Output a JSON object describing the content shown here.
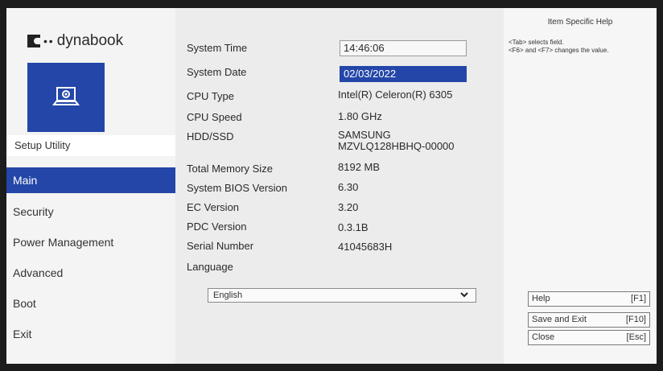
{
  "brand": {
    "logo_text": "dynabook"
  },
  "sidebar": {
    "title": "Setup Utility",
    "items": [
      {
        "label": "Main",
        "active": true
      },
      {
        "label": "Security"
      },
      {
        "label": "Power Management"
      },
      {
        "label": "Advanced"
      },
      {
        "label": "Boot"
      },
      {
        "label": "Exit"
      }
    ]
  },
  "main": {
    "system_time": {
      "label": "System Time",
      "value": "14:46:06"
    },
    "system_date": {
      "label": "System Date",
      "value": "02/03/2022"
    },
    "cpu_type": {
      "label": "CPU Type",
      "value": "Intel(R) Celeron(R) 6305"
    },
    "cpu_speed": {
      "label": "CPU Speed",
      "value": "1.80 GHz"
    },
    "hdd_ssd": {
      "label": "HDD/SSD",
      "value_line1": "SAMSUNG",
      "value_line2": "MZVLQ128HBHQ-00000"
    },
    "total_memory": {
      "label": "Total Memory Size",
      "value": "8192 MB"
    },
    "bios_version": {
      "label": "System BIOS Version",
      "value": "6.30"
    },
    "ec_version": {
      "label": "EC Version",
      "value": "3.20"
    },
    "pdc_version": {
      "label": "PDC Version",
      "value": "0.3.1B"
    },
    "serial_number": {
      "label": "Serial Number",
      "value": "41045683H"
    },
    "language": {
      "label": "Language",
      "value": "English"
    }
  },
  "help": {
    "title": "Item Specific Help",
    "line1": "<Tab> selects field.",
    "line2": "<F6> and <F7> changes the value.",
    "keys": [
      {
        "label": "Help",
        "key": "[F1]"
      },
      {
        "label": "Save and Exit",
        "key": "[F10]"
      },
      {
        "label": "Close",
        "key": "[Esc]"
      }
    ]
  },
  "colors": {
    "accent": "#2346a8",
    "background": "#f1f1f1"
  }
}
